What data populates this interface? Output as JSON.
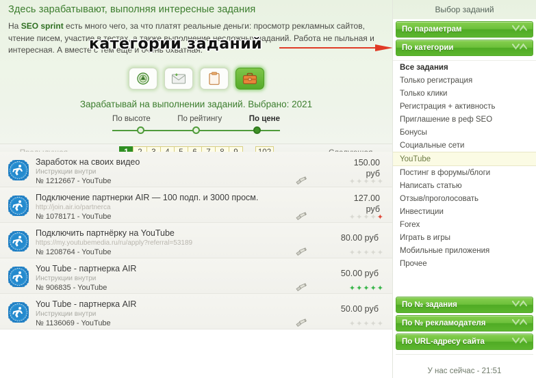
{
  "hero": {
    "title": "Здесь зарабатывают, выполняя интересные задания",
    "paragraph_prefix": "На ",
    "paragraph_brand": "SEO sprint",
    "paragraph_rest": " есть много чего, за что платят реальные деньги: просмотр рекламных сайтов, чтение писем, участие в тестах, а также выполнение несложных заданий. Работа не пыльная и интересная. А вместе с тем ещё и очень охватная.",
    "overlay_text": "категории заданий",
    "overlay_arrow_color": "#e03a26"
  },
  "toolbar": {
    "buttons": [
      {
        "name": "surfing-icon",
        "label": "Сёрфинг",
        "active": false
      },
      {
        "name": "letters-icon",
        "label": "Письма",
        "active": false
      },
      {
        "name": "tests-icon",
        "label": "Тесты",
        "active": false
      },
      {
        "name": "tasks-icon",
        "label": "Задания",
        "active": true
      }
    ]
  },
  "selection": {
    "text": "Зарабатывай на выполнении заданий. Выбрано: 2021",
    "count": 2021
  },
  "sorter": {
    "options": [
      {
        "label": "По высоте",
        "selected": false
      },
      {
        "label": "По рейтингу",
        "selected": false
      },
      {
        "label": "По цене",
        "selected": true
      }
    ]
  },
  "pagination": {
    "prev_label": "← Предыдущая",
    "next_label": "Следующая →",
    "pages": [
      "1",
      "2",
      "3",
      "4",
      "5",
      "6",
      "7",
      "8",
      "9"
    ],
    "ellipsis": "...",
    "last_page": "102",
    "current": "1"
  },
  "tasks": [
    {
      "title": "Заработок на своих видео",
      "subtitle": "Инструкции внутри",
      "subtitle_is_url": false,
      "number": "№ 1212667 - YouTube",
      "price": "150.00",
      "currency": "руб",
      "price_stacked": true,
      "stars": [
        "off",
        "off",
        "off",
        "off",
        "off"
      ]
    },
    {
      "title": "Подключение партнерки AIR — 100 подп. и 3000 просм.",
      "subtitle": "http://join.air.io/partnerca",
      "subtitle_is_url": true,
      "number": "№ 1078171 - YouTube",
      "price": "127.00",
      "currency": "руб",
      "price_stacked": true,
      "stars": [
        "off",
        "off",
        "off",
        "off",
        "red"
      ]
    },
    {
      "title": "Подключить партнёрку на YouTube",
      "subtitle": "https://my.youtubemedia.ru/ru/apply?referral=53189",
      "subtitle_is_url": true,
      "number": "№ 1208764 - YouTube",
      "price": "80.00 руб",
      "currency": "",
      "price_stacked": false,
      "stars": [
        "off",
        "off",
        "off",
        "off",
        "off"
      ]
    },
    {
      "title": "You Tube - партнерка AIR",
      "subtitle": "Инструкции внутри",
      "subtitle_is_url": false,
      "number": "№ 906835 - YouTube",
      "price": "50.00 руб",
      "currency": "",
      "price_stacked": false,
      "stars": [
        "green",
        "green",
        "green",
        "green",
        "green"
      ]
    },
    {
      "title": "You Tube - партнерка AIR",
      "subtitle": "Инструкции внутри",
      "subtitle_is_url": false,
      "number": "№ 1136069 - YouTube",
      "price": "50.00 руб",
      "currency": "",
      "price_stacked": false,
      "stars": [
        "off",
        "off",
        "off",
        "off",
        "off"
      ]
    }
  ],
  "sidebar": {
    "header": "Выбор заданий",
    "top_buttons": [
      {
        "label": "По параметрам"
      },
      {
        "label": "По категории"
      }
    ],
    "categories": [
      {
        "label": "Все задания",
        "style": "bold"
      },
      {
        "label": "Только регистрация",
        "style": "normal"
      },
      {
        "label": "Только клики",
        "style": "normal"
      },
      {
        "label": "Регистрация + активность",
        "style": "normal"
      },
      {
        "label": "Приглашение в реф SEO",
        "style": "normal"
      },
      {
        "label": "Бонусы",
        "style": "normal"
      },
      {
        "label": "Социальные сети",
        "style": "normal"
      },
      {
        "label": "YouTube",
        "style": "selected"
      },
      {
        "label": "Постинг в форумы/блоги",
        "style": "normal"
      },
      {
        "label": "Написать статью",
        "style": "normal"
      },
      {
        "label": "Отзыв/проголосовать",
        "style": "normal"
      },
      {
        "label": "Инвестиции",
        "style": "normal"
      },
      {
        "label": "Forex",
        "style": "normal"
      },
      {
        "label": "Играть в игры",
        "style": "normal"
      },
      {
        "label": "Мобильные приложения",
        "style": "normal"
      },
      {
        "label": "Прочее",
        "style": "normal"
      }
    ],
    "bottom_buttons": [
      {
        "label": "По № задания"
      },
      {
        "label": "По № рекламодателя"
      },
      {
        "label": "По URL-адресу сайта"
      }
    ],
    "clock": "У нас сейчас - 21:51"
  },
  "colors": {
    "green_brand": "#3c7d2e",
    "green_button": "#5cb52e",
    "star_green": "#39b54a",
    "star_red": "#e04a3a",
    "accent_red": "#e03a26"
  }
}
